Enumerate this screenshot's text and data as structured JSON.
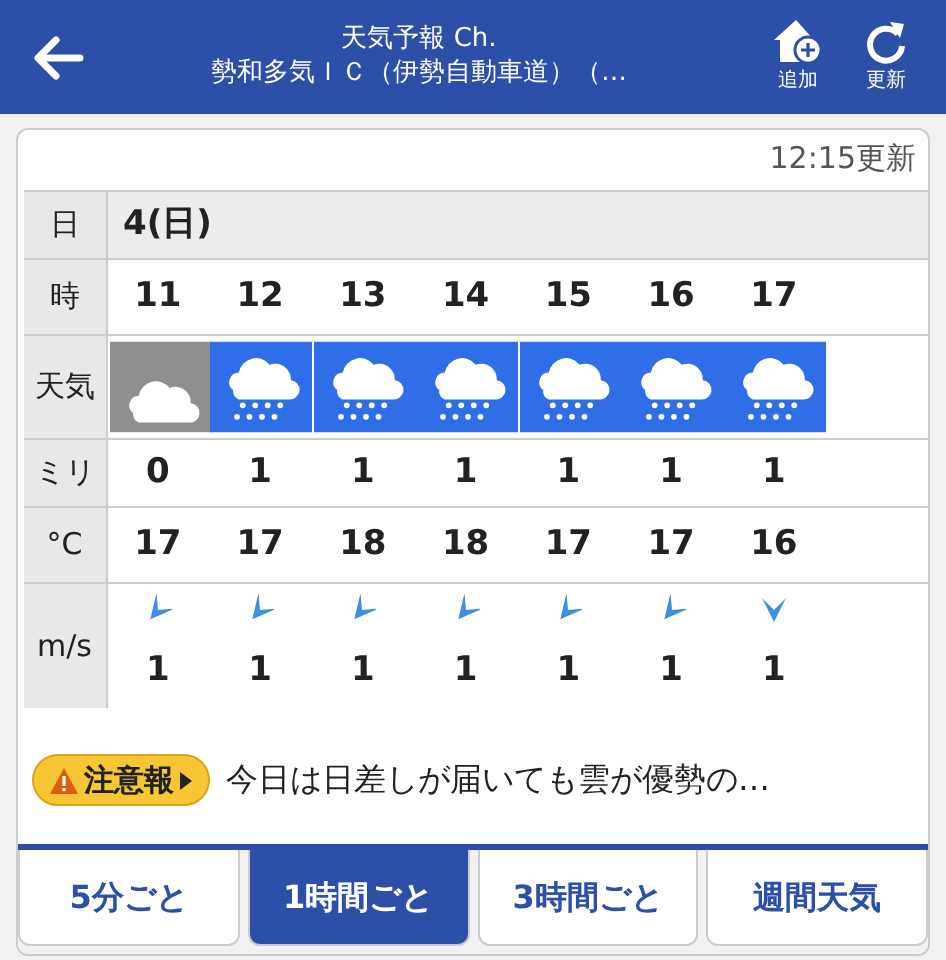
{
  "header": {
    "title": "天気予報 Ch.",
    "subtitle": "勢和多気ＩＣ（伊勢自動車道）（…",
    "actions": [
      {
        "kind": "add",
        "label": "追加"
      },
      {
        "kind": "refresh",
        "label": "更新"
      }
    ]
  },
  "updated": "12:15更新",
  "table": {
    "labels": {
      "day": "日",
      "hour": "時",
      "weather": "天気",
      "rain": "ミリ",
      "temp": "°C",
      "wind": "m/s"
    },
    "day": "4(日)",
    "hours": [
      {
        "hour": "11",
        "weather": {
          "kind": "cloudy"
        },
        "rain": "0",
        "temp": "17",
        "wind": {
          "kind": "northeast",
          "speed": "1"
        }
      },
      {
        "hour": "12",
        "weather": {
          "kind": "rain"
        },
        "rain": "1",
        "temp": "17",
        "wind": {
          "kind": "northeast",
          "speed": "1"
        }
      },
      {
        "hour": "13",
        "weather": {
          "kind": "rain"
        },
        "rain": "1",
        "temp": "18",
        "wind": {
          "kind": "northeast",
          "speed": "1"
        }
      },
      {
        "hour": "14",
        "weather": {
          "kind": "rain"
        },
        "rain": "1",
        "temp": "18",
        "wind": {
          "kind": "northeast",
          "speed": "1"
        }
      },
      {
        "hour": "15",
        "weather": {
          "kind": "rain"
        },
        "rain": "1",
        "temp": "17",
        "wind": {
          "kind": "northeast",
          "speed": "1"
        }
      },
      {
        "hour": "16",
        "weather": {
          "kind": "rain"
        },
        "rain": "1",
        "temp": "17",
        "wind": {
          "kind": "northeast",
          "speed": "1"
        }
      },
      {
        "hour": "17",
        "weather": {
          "kind": "rain"
        },
        "rain": "1",
        "temp": "16",
        "wind": {
          "kind": "north",
          "speed": "1"
        }
      }
    ]
  },
  "alert": {
    "badge": "注意報",
    "text": "今日は日差しが届いても雲が優勢の…"
  },
  "tabs": [
    {
      "label": "5分ごと",
      "selected": false
    },
    {
      "label": "1時間ごと",
      "selected": true
    },
    {
      "label": "3時間ごと",
      "selected": false
    },
    {
      "label": "週間天気",
      "selected": false
    }
  ]
}
